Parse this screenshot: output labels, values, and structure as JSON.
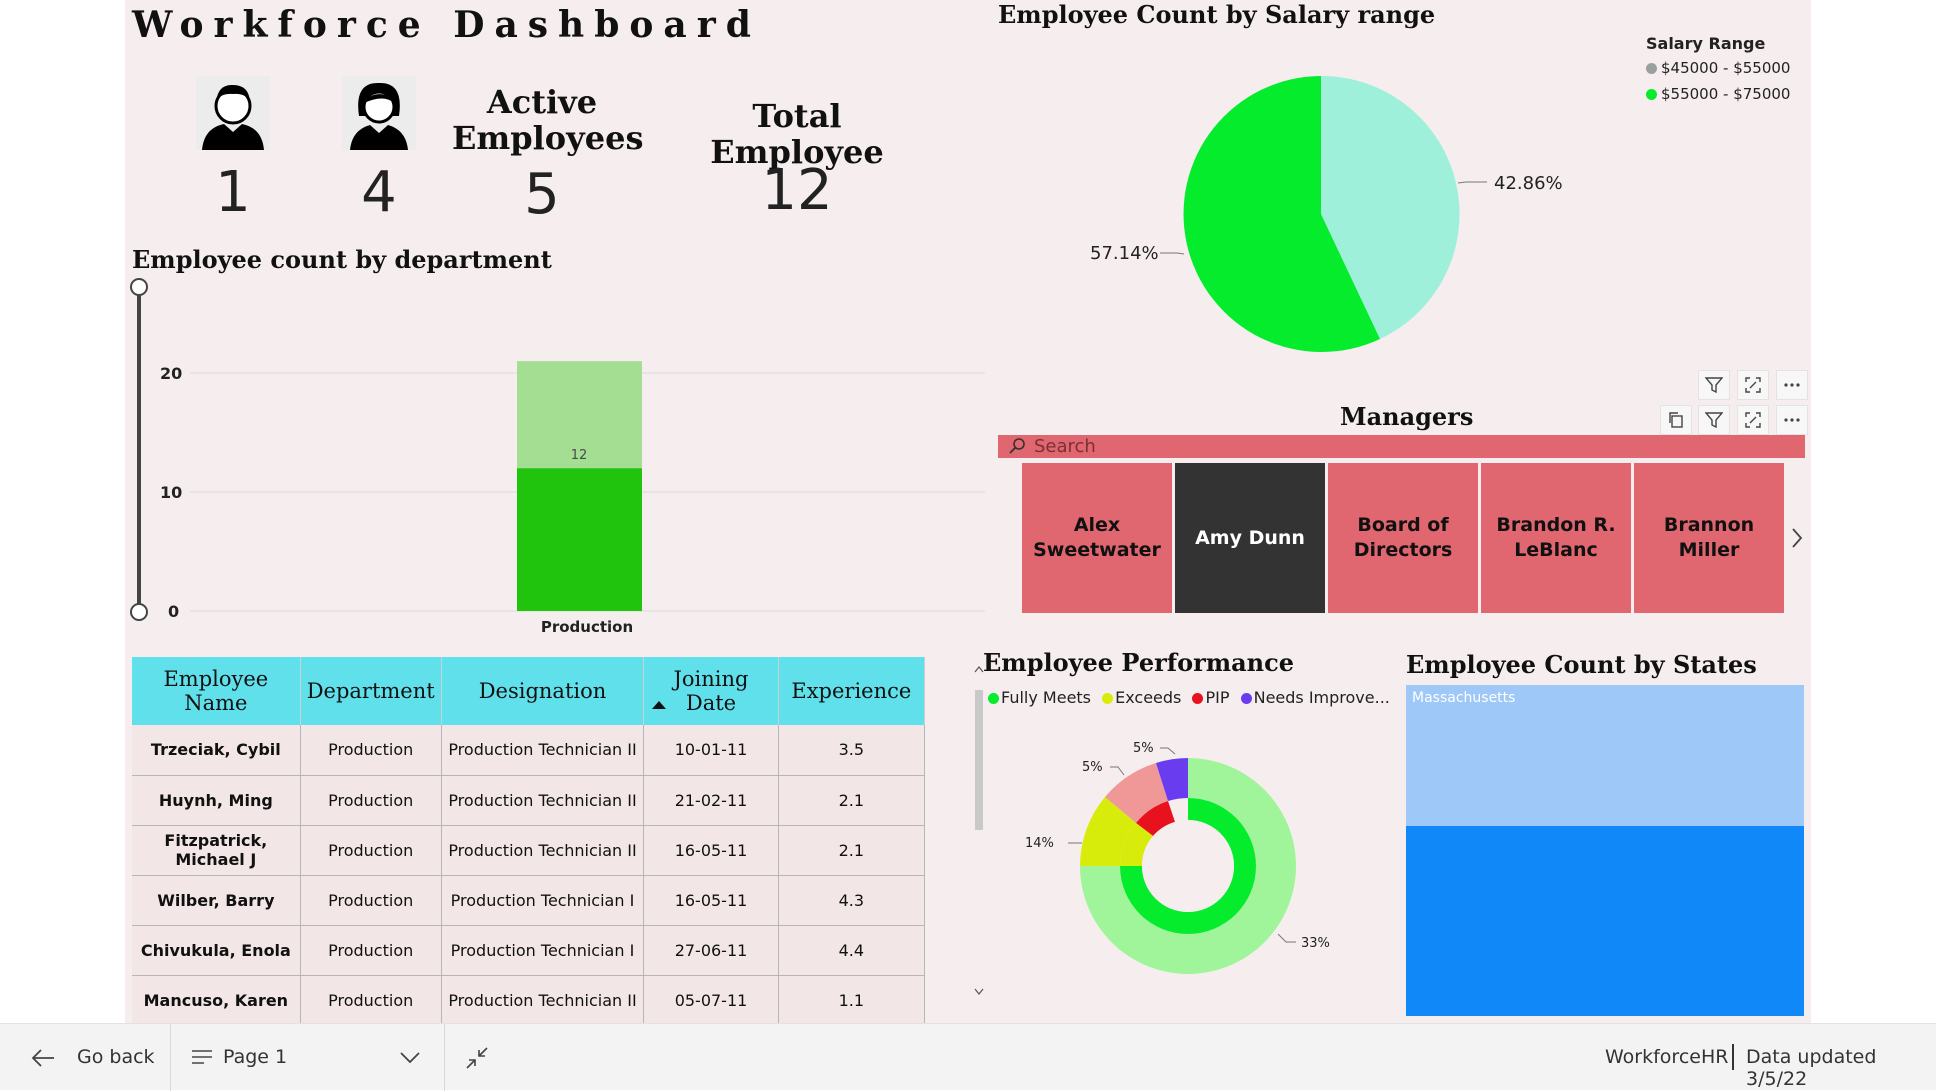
{
  "header": {
    "title": "Workforce  Dashboard"
  },
  "kpis": {
    "male_count": "1",
    "female_count": "4",
    "active_label": "Active Employees",
    "active_value": "5",
    "total_label": "Total Employee",
    "total_value": "12"
  },
  "salary_chart": {
    "title": "Employee Count by Salary range",
    "legend_title": "Salary Range",
    "legend": [
      "$45000 - $55000",
      "$55000 - $75000"
    ],
    "label_a": "42.86%",
    "label_b": "57.14%",
    "colors": {
      "a": "#9ff0da",
      "b": "#04ec2c"
    }
  },
  "dept_chart": {
    "title": "Employee count by department",
    "bar_label": "12",
    "category": "Production"
  },
  "managers": {
    "title": "Managers",
    "search_placeholder": "Search",
    "items": [
      "Alex Sweetwater",
      "Amy Dunn",
      "Board of Directors",
      "Brandon R. LeBlanc",
      "Brannon Miller"
    ],
    "selected": "Amy Dunn"
  },
  "table": {
    "columns": [
      "Employee Name",
      "Department",
      "Designation",
      "Joining Date",
      "Experience"
    ],
    "rows": [
      [
        "Trzeciak, Cybil",
        "Production",
        "Production Technician II",
        "10-01-11",
        "3.5"
      ],
      [
        "Huynh, Ming",
        "Production",
        "Production Technician II",
        "21-02-11",
        "2.1"
      ],
      [
        "Fitzpatrick, Michael J",
        "Production",
        "Production Technician II",
        "16-05-11",
        "2.1"
      ],
      [
        "Wilber, Barry",
        "Production",
        "Production Technician I",
        "16-05-11",
        "4.3"
      ],
      [
        "Chivukula, Enola",
        "Production",
        "Production Technician I",
        "27-06-11",
        "4.4"
      ],
      [
        "Mancuso, Karen",
        "Production",
        "Production Technician II",
        "05-07-11",
        "1.1"
      ]
    ]
  },
  "performance": {
    "title": "Employee Performance",
    "legend": [
      "Fully Meets",
      "Exceeds",
      "PIP",
      "Needs Improve..."
    ],
    "labels": [
      "5%",
      "5%",
      "14%",
      "33%"
    ],
    "colors": {
      "fully": "#04ec2c",
      "exceeds": "#d8ec0c",
      "pip": "#e8121e",
      "needs": "#6a3cf0"
    }
  },
  "states": {
    "title": "Employee Count by States",
    "label": "Massachusetts"
  },
  "footer": {
    "back": "Go back",
    "page": "Page 1",
    "app": "WorkforceHR",
    "updated": "Data updated 3/5/22"
  },
  "chart_data": [
    {
      "type": "pie",
      "title": "Employee Count by Salary range",
      "categories": [
        "$45000 - $55000",
        "$55000 - $75000"
      ],
      "values": [
        42.86,
        57.14
      ]
    },
    {
      "type": "bar",
      "title": "Employee count by department",
      "categories": [
        "Production"
      ],
      "series": [
        {
          "values": [
            12
          ]
        },
        {
          "values": [
            9
          ]
        }
      ],
      "ylim": [
        0,
        22
      ],
      "yticks": [
        0,
        10,
        20
      ]
    },
    {
      "type": "pie",
      "title": "Employee Performance",
      "categories": [
        "Fully Meets",
        "Exceeds",
        "PIP",
        "Needs Improve..."
      ],
      "values": [
        33,
        14,
        5,
        5
      ]
    }
  ]
}
